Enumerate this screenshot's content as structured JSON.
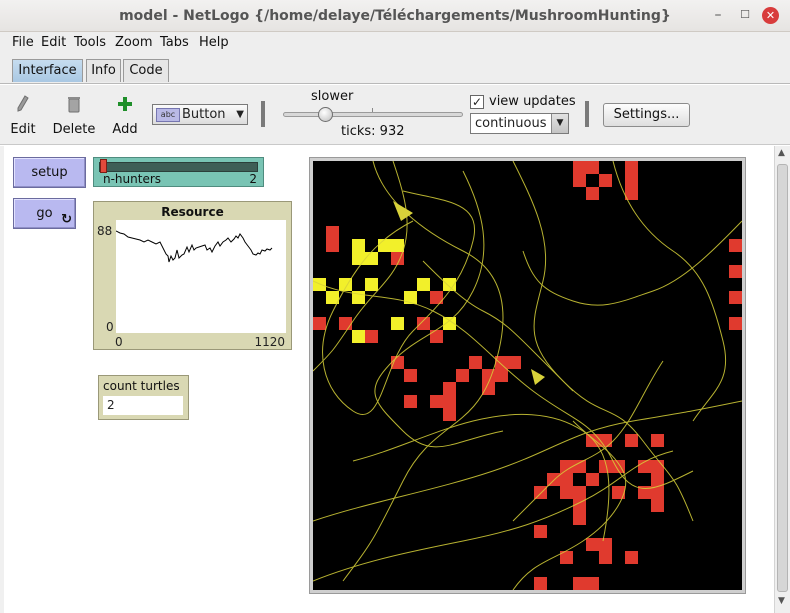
{
  "window": {
    "title": "model - NetLogo {/home/delaye/Téléchargements/MushroomHunting}"
  },
  "menu": [
    "File",
    "Edit",
    "Tools",
    "Zoom",
    "Tabs",
    "Help"
  ],
  "tabs": [
    {
      "label": "Interface",
      "active": true
    },
    {
      "label": "Info",
      "active": false
    },
    {
      "label": "Code",
      "active": false
    }
  ],
  "toolbar": {
    "edit_label": "Edit",
    "delete_label": "Delete",
    "add_label": "Add",
    "widget_type": "Button",
    "widget_badge": "abc",
    "speed_label": "slower",
    "speed_fraction": 0.23,
    "ticks_text": "ticks: 932",
    "view_updates_label": "view updates",
    "view_updates_checked": true,
    "update_mode": "continuous",
    "settings_label": "Settings..."
  },
  "widgets": {
    "setup_label": "setup",
    "go_label": "go",
    "go_forever": true,
    "slider": {
      "name": "n-hunters",
      "value": "2",
      "fraction": 0.0
    },
    "plot": {
      "title": "Resource",
      "ymax": "88",
      "ymin": "0",
      "xmin": "0",
      "xmax": "1120"
    },
    "monitor": {
      "name": "count turtles",
      "value": "2"
    }
  },
  "colors": {
    "button": "#b9b9f0",
    "slider": "#79c4b4",
    "plot_monitor": "#d9d8b3",
    "patch_red": "#e03a2e",
    "patch_yellow": "#f2f02a",
    "trail": "#d8d23a"
  },
  "icons": [
    "pencil-icon",
    "trash-icon",
    "plus-icon",
    "forever-icon",
    "checkmark-icon",
    "chevron-down-icon"
  ]
}
